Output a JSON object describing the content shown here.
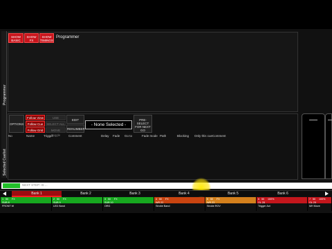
{
  "programmer": {
    "tabs": [
      "SHOW BASIC",
      "SHOW FX",
      "SHOW TIMINGS"
    ],
    "title": "Programmer"
  },
  "left_rail": {
    "top_label": "Programmer",
    "bottom_label": "Selected Cuelist"
  },
  "cuelist_toolbar": {
    "options": "OPTIONS",
    "follow_buttons": [
      "Follow View",
      "Follow Cue",
      "Follow Grid"
    ],
    "dim_buttons": [
      "USE PALETTES",
      "SELECT ALL",
      "MOVE Toggle"
    ],
    "edit_mode": "EDIT MODE",
    "renumber": "RENUMBER",
    "edit_mode_value": "- None Selected -",
    "preselect": "PRE-SELECT FOR NEXT GO"
  },
  "cue_table": {
    "columns": [
      "No",
      "Name",
      "Trigger",
      "Comment",
      "Delay",
      "Fade",
      "Go to",
      "Fade mode",
      "Path",
      "Blocking",
      "Only this cue",
      "Comment"
    ]
  },
  "command_line": {
    "value": "",
    "placeholder": "NEXT STEP: IS ...",
    "accent": "#22c02a"
  },
  "banks": [
    "Bank 1",
    "Bank 2",
    "Bank 3",
    "Bank 4",
    "Bank 5",
    "Bank 6"
  ],
  "playbacks": [
    {
      "num": "1",
      "level": "50",
      "label": "FX",
      "line2": "SUB 8",
      "line3": "FRONT W",
      "color": "#17a81f"
    },
    {
      "num": "2",
      "level": "50",
      "label": "FX",
      "line2": "SUB 9",
      "line3": "LED Band",
      "color": "#17a81f"
    },
    {
      "num": "3",
      "level": "50",
      "label": "FX",
      "line2": "SUB 10",
      "line3": "ORG",
      "color": "#17a81f"
    },
    {
      "num": "4",
      "level": "50",
      "label": "FX",
      "line2": "WR 22",
      "line3": "Strobe Band",
      "color": "#c94410"
    },
    {
      "num": "5",
      "level": "50",
      "label": "FX",
      "line2": "WR 23",
      "line3": "Strobe ROV",
      "color": "#d4801c"
    },
    {
      "num": "6",
      "level": "50",
      "label": "100%",
      "line2": "OL 28",
      "line3": "Trigger Act",
      "color": "#c4161c"
    },
    {
      "num": "7",
      "level": "50",
      "label": "100%",
      "line2": "OL 29",
      "line3": "MH Move",
      "color": "#c4161c"
    }
  ]
}
